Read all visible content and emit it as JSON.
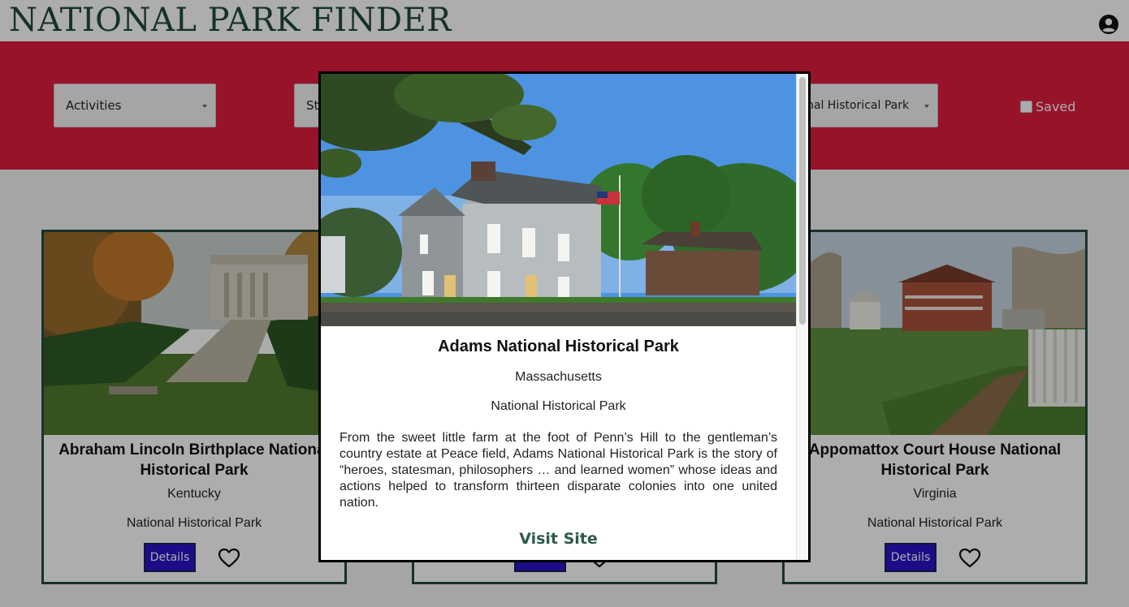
{
  "header": {
    "brand": "NATIONAL PARK FINDER",
    "account_icon": "account-circle-icon"
  },
  "filters": {
    "activities_label": "Activities",
    "states_label": "States",
    "designation_value": "National Historical Park",
    "saved_label": "Saved",
    "saved_checked": false
  },
  "cards": [
    {
      "title": "Abraham Lincoln Birthplace National Historical Park",
      "state": "Kentucky",
      "designation": "National Historical Park",
      "details_label": "Details"
    },
    {
      "title": "",
      "state": "",
      "designation": "",
      "details_label": "Details"
    },
    {
      "title": "Appomattox Court House National Historical Park",
      "state": "Virginia",
      "designation": "National Historical Park",
      "details_label": "Details"
    }
  ],
  "modal": {
    "title": "Adams National Historical Park",
    "state": "Massachusetts",
    "designation": "National Historical Park",
    "description": "From the sweet little farm at the foot of Penn’s Hill to the gentleman’s country estate at Peace field, Adams National Historical Park is the story of “heroes, statesman, philosophers … and learned women” whose ideas and actions helped to transform thirteen disparate colonies into one united nation.",
    "visit_label": "Visit Site"
  },
  "colors": {
    "brand_green": "#1f4a38",
    "filter_red": "#df1c3e",
    "details_blue": "#2a12c8",
    "card_border": "#264a40"
  }
}
